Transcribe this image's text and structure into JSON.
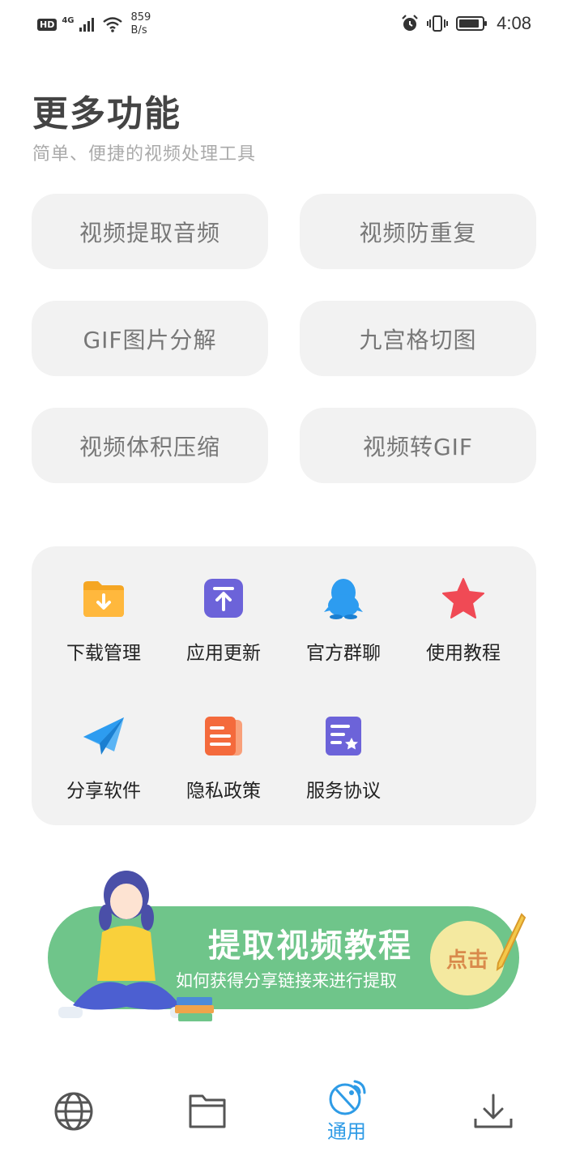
{
  "status_bar": {
    "hd": "HD",
    "network": "4G",
    "speed_value": "859",
    "speed_unit": "B/s",
    "time": "4:08"
  },
  "header": {
    "title": "更多功能",
    "subtitle": "简单、便捷的视频处理工具"
  },
  "features": [
    {
      "label": "视频提取音频"
    },
    {
      "label": "视频防重复"
    },
    {
      "label": "GIF图片分解"
    },
    {
      "label": "九宫格切图"
    },
    {
      "label": "视频体积压缩"
    },
    {
      "label": "视频转GIF"
    }
  ],
  "tools": [
    {
      "label": "下载管理",
      "icon": "folder-download-icon",
      "color": "#f5a623"
    },
    {
      "label": "应用更新",
      "icon": "update-icon",
      "color": "#6c63d9"
    },
    {
      "label": "官方群聊",
      "icon": "qq-penguin-icon",
      "color": "#2d9cf0"
    },
    {
      "label": "使用教程",
      "icon": "star-icon",
      "color": "#f04a55"
    },
    {
      "label": "分享软件",
      "icon": "paper-plane-icon",
      "color": "#2d9cf0"
    },
    {
      "label": "隐私政策",
      "icon": "document-icon",
      "color": "#f46a3c"
    },
    {
      "label": "服务协议",
      "icon": "agreement-icon",
      "color": "#6c63d9"
    }
  ],
  "banner": {
    "title": "提取视频教程",
    "subtitle": "如何获得分享链接来进行提取",
    "cta": "点击"
  },
  "bottom_nav": {
    "items": [
      {
        "icon": "globe-icon"
      },
      {
        "icon": "folder-icon"
      },
      {
        "icon": "satellite-icon",
        "label": "通用",
        "active": true
      },
      {
        "icon": "download-icon"
      }
    ],
    "active_color": "#2e9be6"
  }
}
